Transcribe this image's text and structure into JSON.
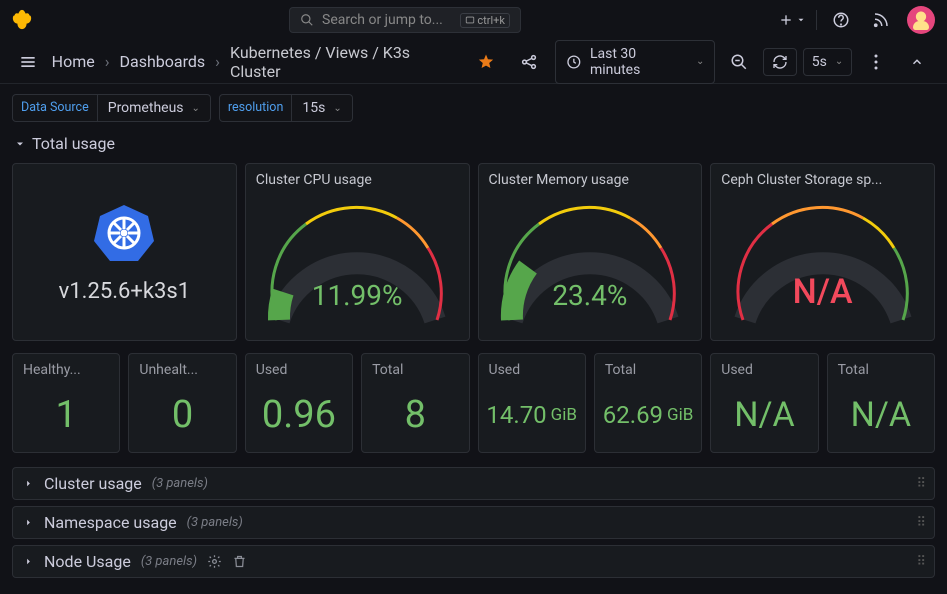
{
  "search": {
    "placeholder": "Search or jump to...",
    "shortcut": "ctrl+k"
  },
  "breadcrumbs": {
    "home": "Home",
    "dashboards": "Dashboards",
    "current": "Kubernetes / Views / K3s Cluster"
  },
  "toolbar": {
    "time_range": "Last 30 minutes",
    "refresh_interval": "5s"
  },
  "variables": {
    "datasource_label": "Data Source",
    "datasource_value": "Prometheus",
    "resolution_label": "resolution",
    "resolution_value": "15s"
  },
  "section": {
    "title": "Total usage"
  },
  "panels": {
    "k8s_version": "v1.25.6+k3s1",
    "cpu": {
      "title": "Cluster CPU usage",
      "value": "11.99%",
      "fraction": 0.1199
    },
    "memory": {
      "title": "Cluster Memory usage",
      "value": "23.4%",
      "fraction": 0.234
    },
    "ceph": {
      "title": "Ceph Cluster Storage sp...",
      "value": "N/A",
      "fraction": 0
    }
  },
  "stats": {
    "healthy": {
      "title": "Healthy...",
      "value": "1"
    },
    "unhealthy": {
      "title": "Unhealt...",
      "value": "0"
    },
    "cpu_used": {
      "title": "Used",
      "value": "0.96"
    },
    "cpu_total": {
      "title": "Total",
      "value": "8"
    },
    "mem_used": {
      "title": "Used",
      "value": "14.70",
      "unit": "GiB"
    },
    "mem_total": {
      "title": "Total",
      "value": "62.69",
      "unit": "GiB"
    },
    "ceph_used": {
      "title": "Used",
      "value": "N/A"
    },
    "ceph_total": {
      "title": "Total",
      "value": "N/A"
    }
  },
  "collapsed": {
    "cluster": {
      "title": "Cluster usage",
      "count": "(3 panels)"
    },
    "namespace": {
      "title": "Namespace usage",
      "count": "(3 panels)"
    },
    "node": {
      "title": "Node Usage",
      "count": "(3 panels)"
    }
  },
  "chart_data": [
    {
      "type": "gauge",
      "title": "Cluster CPU usage",
      "value": 11.99,
      "unit": "%",
      "range": [
        0,
        100
      ],
      "thresholds": [
        70,
        85
      ]
    },
    {
      "type": "gauge",
      "title": "Cluster Memory usage",
      "value": 23.4,
      "unit": "%",
      "range": [
        0,
        100
      ],
      "thresholds": [
        70,
        85
      ]
    },
    {
      "type": "gauge",
      "title": "Ceph Cluster Storage space usage",
      "value": null,
      "unit": "%",
      "range": [
        0,
        100
      ],
      "thresholds": [
        70,
        85
      ]
    }
  ]
}
